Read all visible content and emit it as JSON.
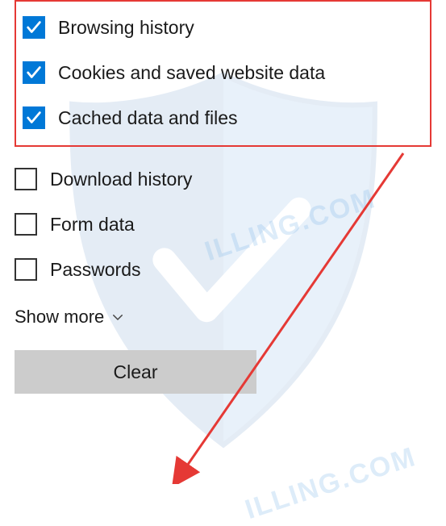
{
  "options": [
    {
      "label": "Browsing history",
      "checked": true
    },
    {
      "label": "Cookies and saved website data",
      "checked": true
    },
    {
      "label": "Cached data and files",
      "checked": true
    },
    {
      "label": "Download history",
      "checked": false
    },
    {
      "label": "Form data",
      "checked": false
    },
    {
      "label": "Passwords",
      "checked": false
    }
  ],
  "show_more_label": "Show more",
  "clear_button_label": "Clear",
  "colors": {
    "accent": "#0078d7",
    "highlight_border": "#e53935",
    "button_bg": "#cccccc"
  }
}
